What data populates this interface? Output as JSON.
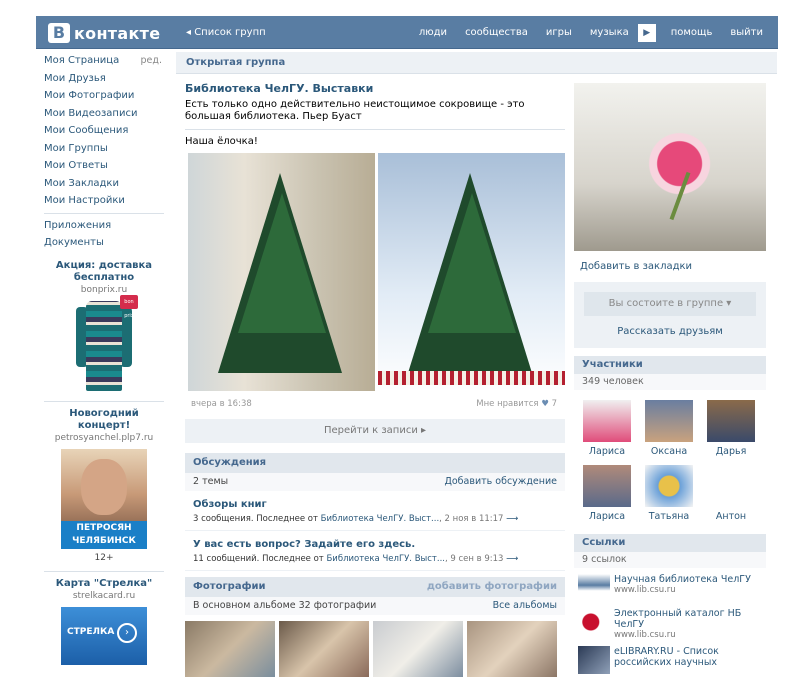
{
  "header": {
    "logo_letter": "В",
    "logo_text": "контакте",
    "back": "◂ Список групп",
    "nav": [
      "люди",
      "сообщества",
      "игры",
      "музыка"
    ],
    "nav_more": "▶",
    "nav_right": [
      "помощь",
      "выйти"
    ]
  },
  "left_menu": {
    "items": [
      "Моя Страница",
      "Мои Друзья",
      "Мои Фотографии",
      "Мои Видеозаписи",
      "Мои Сообщения",
      "Мои Группы",
      "Мои Ответы",
      "Мои Закладки",
      "Мои Настройки"
    ],
    "edit": "ред.",
    "extra": [
      "Приложения",
      "Документы"
    ]
  },
  "ads": [
    {
      "title": "Акция: доставка бесплатно",
      "domain": "bonprix.ru",
      "badge": "bon prix"
    },
    {
      "title": "Новогодний концерт!",
      "domain": "petrosyanchel.plp7.ru",
      "banner": "ПЕТРОСЯН ЧЕЛЯБИНСК",
      "age": "12+"
    },
    {
      "title": "Карта \"Стрелка\"",
      "domain": "strelkacard.ru",
      "banner": "СТРЕЛКА"
    }
  ],
  "group": {
    "type": "Открытая группа",
    "name": "Библиотека ЧелГУ. Выставки",
    "status": "Есть только одно действительно неистощимое сокровище - это большая библиотека. Пьер Буаст"
  },
  "post": {
    "text": "Наша ёлочка!",
    "time": "вчера в 16:38",
    "like_label": "Мне нравится",
    "likes": "7",
    "goto": "Перейти к записи ▸"
  },
  "discussions": {
    "title": "Обсуждения",
    "count": "2 темы",
    "add": "Добавить обсуждение",
    "topics": [
      {
        "title": "Обзоры книг",
        "info": "3 сообщения. Последнее от ",
        "from": "Библиотека ЧелГУ. Выст...",
        "date": ", 2 ноя в 11:17",
        "arrow": "⟶"
      },
      {
        "title": "У вас есть вопрос? Задайте его здесь.",
        "info": "11 сообщений. Последнее от ",
        "from": "Библиотека ЧелГУ. Выст...",
        "date": ", 9 сен в 9:13",
        "arrow": "⟶"
      }
    ]
  },
  "photos": {
    "title": "Фотографии",
    "add": "добавить фотографии",
    "sub": "В основном альбоме 32 фотографии",
    "all": "Все альбомы"
  },
  "right": {
    "bookmark": "Добавить в закладки",
    "member_btn": "Вы состоите в группе ▾",
    "share": "Рассказать друзьям",
    "members_title": "Участники",
    "members_count": "349 человек",
    "members": [
      "Лариса",
      "Оксана",
      "Дарья",
      "Лариса",
      "Татьяна",
      "Антон"
    ],
    "links_title": "Ссылки",
    "links_count": "9 ссылок",
    "links": [
      {
        "title": "Научная библиотека ЧелГУ",
        "url": "www.lib.csu.ru"
      },
      {
        "title": "Электронный каталог НБ ЧелГУ",
        "url": "www.lib.csu.ru"
      },
      {
        "title": "eLIBRARY.RU - Список российских научных",
        "url": ""
      }
    ]
  }
}
